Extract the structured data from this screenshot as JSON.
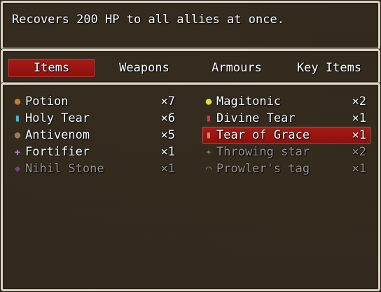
{
  "help": {
    "description": "Recovers 200 HP to all allies at once."
  },
  "categories": [
    {
      "label": "Items",
      "selected": true
    },
    {
      "label": "Weapons",
      "selected": false
    },
    {
      "label": "Armours",
      "selected": false
    },
    {
      "label": "Key Items",
      "selected": false
    }
  ],
  "items": [
    {
      "name": "Potion",
      "count": "×7",
      "icon": "potion-icon",
      "glyph": "●",
      "color": "#c9792b",
      "enabled": true,
      "selected": false
    },
    {
      "name": "Magitonic",
      "count": "×2",
      "icon": "magitonic-icon",
      "glyph": "●",
      "color": "#d8e23a",
      "enabled": true,
      "selected": false
    },
    {
      "name": "Holy Tear",
      "count": "×6",
      "icon": "holy-tear-icon",
      "glyph": "▮",
      "color": "#4fb7c9",
      "enabled": true,
      "selected": false
    },
    {
      "name": "Divine Tear",
      "count": "×1",
      "icon": "divine-tear-icon",
      "glyph": "▮",
      "color": "#e0344d",
      "enabled": true,
      "selected": false
    },
    {
      "name": "Antivenom",
      "count": "×5",
      "icon": "antivenom-icon",
      "glyph": "●",
      "color": "#9b7a55",
      "enabled": true,
      "selected": false
    },
    {
      "name": "Tear of Grace",
      "count": "×1",
      "icon": "tear-of-grace-icon",
      "glyph": "▮",
      "color": "#e08a45",
      "enabled": true,
      "selected": true
    },
    {
      "name": "Fortifier",
      "count": "×1",
      "icon": "fortifier-icon",
      "glyph": "✚",
      "color": "#a877e0",
      "enabled": true,
      "selected": false
    },
    {
      "name": "Throwing star",
      "count": "×2",
      "icon": "throwing-star-icon",
      "glyph": "✦",
      "color": "#b9b9b9",
      "enabled": false,
      "selected": false
    },
    {
      "name": "Nihil Stone",
      "count": "×1",
      "icon": "nihil-stone-icon",
      "glyph": "◆",
      "color": "#a25cc4",
      "enabled": false,
      "selected": false
    },
    {
      "name": "Prowler's tag",
      "count": "×1",
      "icon": "prowlers-tag-icon",
      "glyph": "⌒",
      "color": "#c7c7c7",
      "enabled": false,
      "selected": false
    }
  ]
}
